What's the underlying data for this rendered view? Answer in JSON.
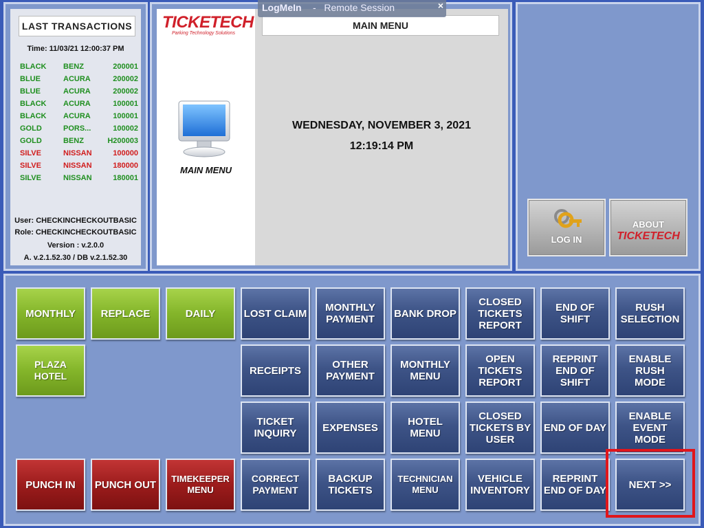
{
  "session": {
    "app": "LogMeIn",
    "separator": "-",
    "title": "Remote Session",
    "close": "×"
  },
  "transactions": {
    "title": "LAST TRANSACTIONS",
    "time": "Time: 11/03/21 12:00:37 PM",
    "rows": [
      {
        "color": "BLACK",
        "make": "BENZ",
        "ticket": "200001",
        "status": "green"
      },
      {
        "color": "BLUE",
        "make": "ACURA",
        "ticket": "200002",
        "status": "green"
      },
      {
        "color": "BLUE",
        "make": "ACURA",
        "ticket": "200002",
        "status": "green"
      },
      {
        "color": "BLACK",
        "make": "ACURA",
        "ticket": "100001",
        "status": "green"
      },
      {
        "color": "BLACK",
        "make": "ACURA",
        "ticket": "100001",
        "status": "green"
      },
      {
        "color": "GOLD",
        "make": "PORS...",
        "ticket": "100002",
        "status": "green"
      },
      {
        "color": "GOLD",
        "make": "BENZ",
        "ticket": "H200003",
        "status": "green"
      },
      {
        "color": "SILVE",
        "make": "NISSAN",
        "ticket": "100000",
        "status": "red"
      },
      {
        "color": "SILVE",
        "make": "NISSAN",
        "ticket": "180000",
        "status": "red"
      },
      {
        "color": "SILVE",
        "make": "NISSAN",
        "ticket": "180001",
        "status": "green"
      }
    ],
    "user": "User: CHECKINCHECKOUTBASIC",
    "role": "Role: CHECKINCHECKOUTBASIC",
    "version": "Version : v.2.0.0",
    "build": "A. v.2.1.52.30 / DB v.2.1.52.30"
  },
  "brand": {
    "name": "TICKETECH",
    "tagline": "Parking Technology Solutions",
    "accent": "#d0202a"
  },
  "center": {
    "title": "MAIN MENU",
    "icon_caption": "MAIN MENU",
    "date": "WEDNESDAY, NOVEMBER 3, 2021",
    "time": "12:19:14 PM"
  },
  "right": {
    "login_label": "LOG IN",
    "about_label": "ABOUT",
    "about_brand": "TICKETECH"
  },
  "buttons": {
    "monthly": "MONTHLY",
    "replace": "REPLACE",
    "daily": "DAILY",
    "plaza_hotel": "PLAZA HOTEL",
    "punch_in": "PUNCH IN",
    "punch_out": "PUNCH OUT",
    "timekeeper_menu": "TIMEKEEPER\nMENU",
    "lost_claim": "LOST CLAIM",
    "monthly_payment": "MONTHLY\nPAYMENT",
    "bank_drop": "BANK DROP",
    "closed_tickets_report": "CLOSED\nTICKETS\nREPORT",
    "end_of_shift": "END OF\nSHIFT",
    "rush_selection": "RUSH\nSELECTION",
    "receipts": "RECEIPTS",
    "other_payment": "OTHER\nPAYMENT",
    "monthly_menu": "MONTHLY\nMENU",
    "open_tickets_report": "OPEN\nTICKETS\nREPORT",
    "reprint_end_of_shift": "REPRINT\nEND OF\nSHIFT",
    "enable_rush_mode": "ENABLE\nRUSH\nMODE",
    "ticket_inquiry": "TICKET\nINQUIRY",
    "expenses": "EXPENSES",
    "hotel_menu": "HOTEL\nMENU",
    "closed_tickets_by_user": "CLOSED\nTICKETS BY\nUSER",
    "end_of_day": "END OF DAY",
    "enable_event_mode": "ENABLE\nEVENT\nMODE",
    "correct_payment": "CORRECT\nPAYMENT",
    "backup_tickets": "BACKUP\nTICKETS",
    "technician_menu": "TECHNICIAN\nMENU",
    "vehicle_inventory": "VEHICLE\nINVENTORY",
    "reprint_end_of_day": "REPRINT\nEND OF DAY",
    "next": "NEXT >>"
  },
  "colors": {
    "green_btn": "#84b52a",
    "red_btn": "#9c1c1c",
    "blue_btn": "#3e5487",
    "highlight": "#e0161b"
  }
}
